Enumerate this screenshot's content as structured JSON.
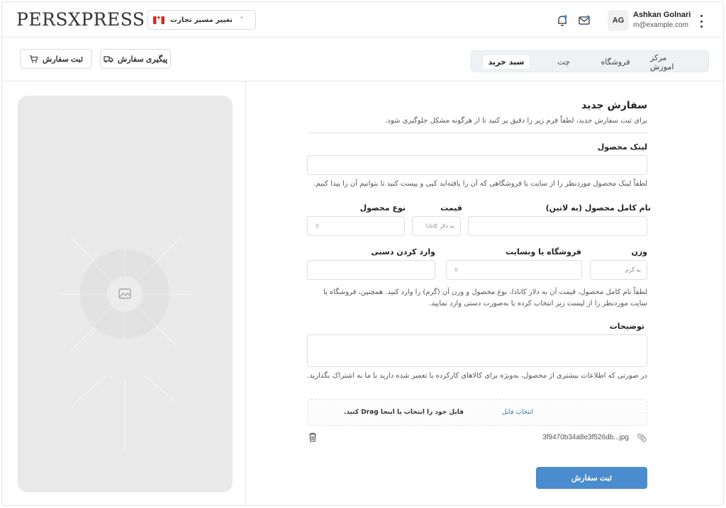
{
  "header": {
    "logo": "PERSXPRESS",
    "route_select": {
      "label": "تغییر مسیر تجارت",
      "flag_icon": "canada-flag-icon"
    },
    "user": {
      "initials": "AG",
      "name": "Ashkan Golnari",
      "email": "m@example.com"
    }
  },
  "toolbar": {
    "register_order": "ثبت سفارش",
    "track_order": "پیگیری سفارش"
  },
  "tabs": [
    {
      "label": "مرکز اموزش",
      "active": false
    },
    {
      "label": "فروشگاه",
      "active": false
    },
    {
      "label": "چت",
      "active": false
    },
    {
      "label": "سبد خرید",
      "active": true
    }
  ],
  "form": {
    "title": "سفارش جدید",
    "subtitle": "برای ثبت سفارش جدید، لطفاً فرم زیر را دقیق پر کنید تا از هرگونه مشکل جلوگیری شود.",
    "product_link": {
      "label": "لینک محصول",
      "help": "لطفاً لینک محصول موردنظر را از سایت یا فروشگاهی که آن را یافته‌اید کپی و پیست کنید تا بتوانیم آن را پیدا کنیم."
    },
    "full_name": {
      "label": "نام کامل محصول (به لاتین)"
    },
    "price": {
      "label": "قیمت",
      "placeholder": "به دلار کانادا"
    },
    "product_type": {
      "label": "نوع محصول"
    },
    "weight": {
      "label": "وزن",
      "placeholder": "به گرم"
    },
    "store": {
      "label": "فروشگاه یا وبسایت"
    },
    "manual": {
      "label": "وارد کردن دستی"
    },
    "details_help": "لطفاً نام کامل محصول، قیمت آن به دلار کانادا، نوع محصول و وزن آن (گرم) را وارد کنید. همچنین، فروشگاه یا سایت موردنظر را از لیست زیر انتخاب کرده یا به‌صورت دستی وارد نمایید.",
    "description": {
      "label": "توضیحات",
      "help": "در صورتی که اطلاعات بیشتری از محصول، به‌ویژه برای کالاهای کارکرده یا تعمیر شده دارید با ما به اشتراک بگذارید."
    },
    "upload": {
      "text": "فایل خود را انتخاب یا اینجا Drag کنید.",
      "link": "انتخاب فایل"
    },
    "attached_file": "3f9470b34a8e3f526db...jpg",
    "submit": "ثبت سفارش"
  }
}
